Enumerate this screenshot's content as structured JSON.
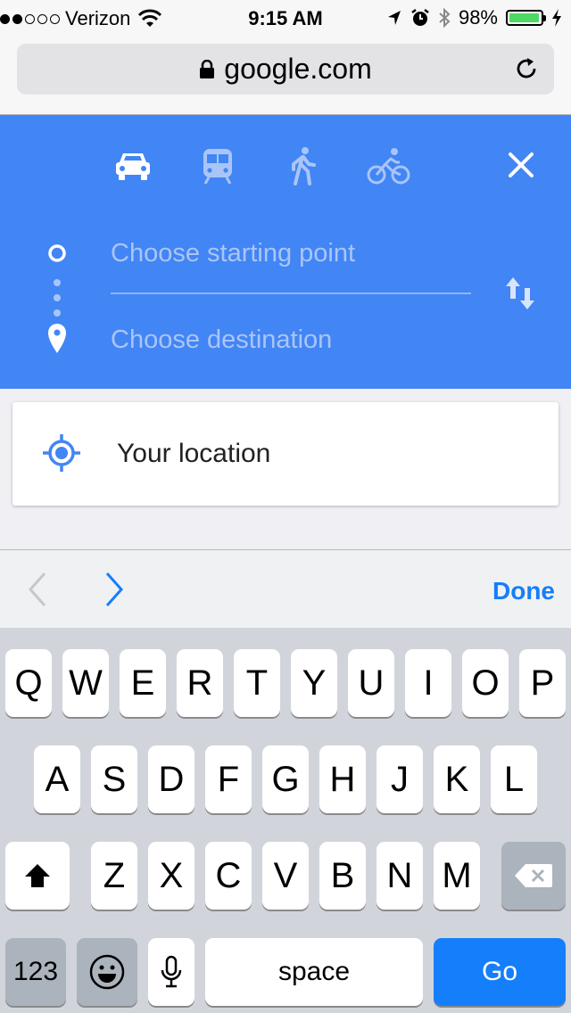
{
  "status_bar": {
    "carrier": "Verizon",
    "signal_full": 2,
    "signal_total": 5,
    "time": "9:15 AM",
    "battery": "98%",
    "battery_level": 0.98
  },
  "browser": {
    "url": "google.com"
  },
  "directions": {
    "travel_modes": [
      "car-icon",
      "transit-icon",
      "walk-icon",
      "bicycle-icon"
    ],
    "start_placeholder": "Choose starting point",
    "destination_placeholder": "Choose destination",
    "accent_color": "#4285f4"
  },
  "suggestion": {
    "label": "Your location"
  },
  "keyboard_accessory": {
    "done_label": "Done"
  },
  "keyboard": {
    "row1": [
      "Q",
      "W",
      "E",
      "R",
      "T",
      "Y",
      "U",
      "I",
      "O",
      "P"
    ],
    "row2": [
      "A",
      "S",
      "D",
      "F",
      "G",
      "H",
      "J",
      "K",
      "L"
    ],
    "row3": [
      "Z",
      "X",
      "C",
      "V",
      "B",
      "N",
      "M"
    ],
    "numbers_label": "123",
    "space_label": "space",
    "go_label": "Go",
    "go_color": "#157efb"
  }
}
